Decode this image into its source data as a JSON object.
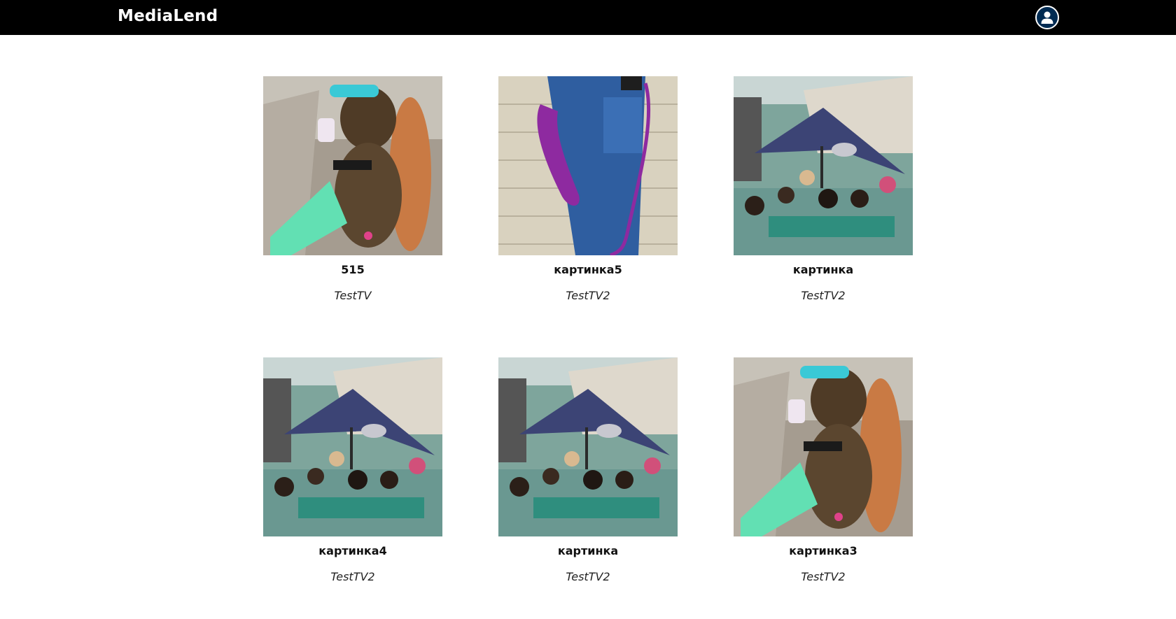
{
  "header": {
    "brand": "MediaLend",
    "profile_icon": "user-circle-icon"
  },
  "media": {
    "items": [
      {
        "title": "515",
        "channel": "TestTV",
        "image": "monkey-with-sunglasses"
      },
      {
        "title": "картинка5",
        "channel": "TestTV2",
        "image": "phone-handset-on-jeans"
      },
      {
        "title": "картинка",
        "channel": "TestTV2",
        "image": "umbrella-in-water"
      },
      {
        "title": "картинка4",
        "channel": "TestTV2",
        "image": "umbrella-in-water"
      },
      {
        "title": "картинка",
        "channel": "TestTV2",
        "image": "umbrella-in-water"
      },
      {
        "title": "картинка3",
        "channel": "TestTV2",
        "image": "monkey-with-sunglasses"
      }
    ]
  },
  "colors": {
    "header_bg": "#000000",
    "page_bg": "#ffffff",
    "profile_bg": "#002b52"
  }
}
